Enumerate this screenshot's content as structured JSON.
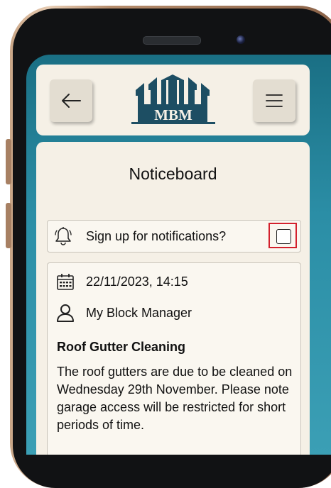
{
  "header": {
    "back_icon": "arrow-left-icon",
    "menu_icon": "hamburger-menu-icon",
    "logo_text": "MBM"
  },
  "page": {
    "title": "Noticeboard"
  },
  "notifications": {
    "icon": "bell-icon",
    "label": "Sign up for notifications?",
    "checked": false,
    "highlight_color": "#d3212d"
  },
  "notice": {
    "date_icon": "calendar-icon",
    "datetime": "22/11/2023, 14:15",
    "author_icon": "user-icon",
    "author": "My Block Manager",
    "title": "Roof Gutter Cleaning",
    "body": "The roof gutters are due to be cleaned on Wednesday 29th November. Please note garage access will be restricted for short periods of time."
  },
  "colors": {
    "screen_background": "#2b8ea6",
    "card_background": "#f5f0e6",
    "logo_color": "#1d4e63"
  }
}
